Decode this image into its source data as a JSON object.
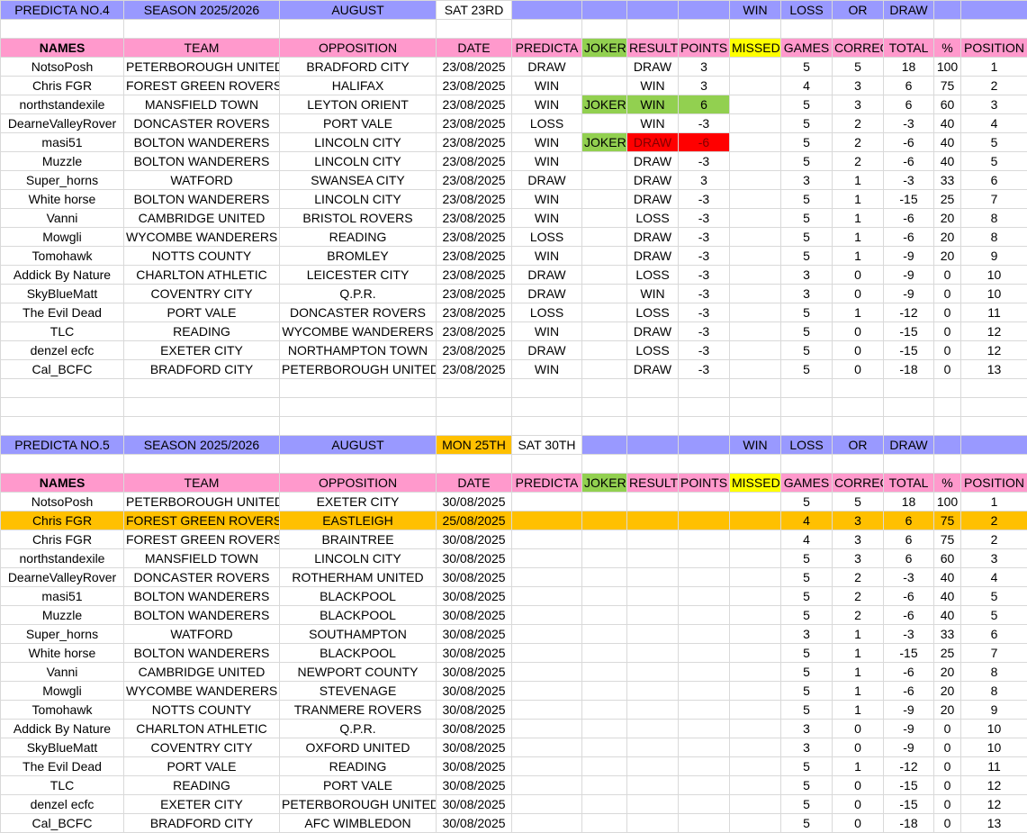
{
  "sheet1": {
    "banner": {
      "title": "PREDICTA NO.4",
      "season": "SEASON 2025/2026",
      "month": "AUGUST",
      "date1": "SAT 23RD",
      "win": "WIN",
      "loss": "LOSS",
      "or": "OR",
      "draw": "DRAW"
    },
    "headers": [
      "NAMES",
      "TEAM",
      "OPPOSITION",
      "DATE",
      "PREDICTA",
      "JOKER",
      "RESULT",
      "POINTS",
      "MISSED",
      "GAMES",
      "CORRECT",
      "TOTAL",
      "%",
      "POSITION"
    ],
    "rows": [
      [
        "NotsoPosh",
        "PETERBOROUGH UNITED",
        "BRADFORD CITY",
        "23/08/2025",
        "DRAW",
        "",
        "DRAW",
        "3",
        "",
        "5",
        "5",
        "18",
        "100",
        "1"
      ],
      [
        "Chris FGR",
        "FOREST GREEN ROVERS",
        "HALIFAX",
        "23/08/2025",
        "WIN",
        "",
        "WIN",
        "3",
        "",
        "4",
        "3",
        "6",
        "75",
        "2"
      ],
      [
        "northstandexile",
        "MANSFIELD TOWN",
        "LEYTON ORIENT",
        "23/08/2025",
        "WIN",
        "JOKER",
        "WIN",
        "6",
        "",
        "5",
        "3",
        "6",
        "60",
        "3"
      ],
      [
        "DearneValleyRover",
        "DONCASTER ROVERS",
        "PORT VALE",
        "23/08/2025",
        "LOSS",
        "",
        "WIN",
        "-3",
        "",
        "5",
        "2",
        "-3",
        "40",
        "4"
      ],
      [
        "masi51",
        "BOLTON WANDERERS",
        "LINCOLN CITY",
        "23/08/2025",
        "WIN",
        "JOKER",
        "DRAW",
        "-6",
        "",
        "5",
        "2",
        "-6",
        "40",
        "5"
      ],
      [
        "Muzzle",
        "BOLTON WANDERERS",
        "LINCOLN CITY",
        "23/08/2025",
        "WIN",
        "",
        "DRAW",
        "-3",
        "",
        "5",
        "2",
        "-6",
        "40",
        "5"
      ],
      [
        "Super_horns",
        "WATFORD",
        "SWANSEA CITY",
        "23/08/2025",
        "DRAW",
        "",
        "DRAW",
        "3",
        "",
        "3",
        "1",
        "-3",
        "33",
        "6"
      ],
      [
        "White horse",
        "BOLTON WANDERERS",
        "LINCOLN CITY",
        "23/08/2025",
        "WIN",
        "",
        "DRAW",
        "-3",
        "",
        "5",
        "1",
        "-15",
        "25",
        "7"
      ],
      [
        "Vanni",
        "CAMBRIDGE UNITED",
        "BRISTOL ROVERS",
        "23/08/2025",
        "WIN",
        "",
        "LOSS",
        "-3",
        "",
        "5",
        "1",
        "-6",
        "20",
        "8"
      ],
      [
        "Mowgli",
        "WYCOMBE WANDERERS",
        "READING",
        "23/08/2025",
        "LOSS",
        "",
        "DRAW",
        "-3",
        "",
        "5",
        "1",
        "-6",
        "20",
        "8"
      ],
      [
        "Tomohawk",
        "NOTTS COUNTY",
        "BROMLEY",
        "23/08/2025",
        "WIN",
        "",
        "DRAW",
        "-3",
        "",
        "5",
        "1",
        "-9",
        "20",
        "9"
      ],
      [
        "Addick By Nature",
        "CHARLTON ATHLETIC",
        "LEICESTER CITY",
        "23/08/2025",
        "DRAW",
        "",
        "LOSS",
        "-3",
        "",
        "3",
        "0",
        "-9",
        "0",
        "10"
      ],
      [
        "SkyBlueMatt",
        "COVENTRY CITY",
        "Q.P.R.",
        "23/08/2025",
        "DRAW",
        "",
        "WIN",
        "-3",
        "",
        "3",
        "0",
        "-9",
        "0",
        "10"
      ],
      [
        "The Evil Dead",
        "PORT VALE",
        "DONCASTER ROVERS",
        "23/08/2025",
        "LOSS",
        "",
        "LOSS",
        "-3",
        "",
        "5",
        "1",
        "-12",
        "0",
        "11"
      ],
      [
        "TLC",
        "READING",
        "WYCOMBE WANDERERS",
        "23/08/2025",
        "WIN",
        "",
        "DRAW",
        "-3",
        "",
        "5",
        "0",
        "-15",
        "0",
        "12"
      ],
      [
        "denzel ecfc",
        "EXETER CITY",
        "NORTHAMPTON TOWN",
        "23/08/2025",
        "DRAW",
        "",
        "LOSS",
        "-3",
        "",
        "5",
        "0",
        "-15",
        "0",
        "12"
      ],
      [
        "Cal_BCFC",
        "BRADFORD CITY",
        "PETERBOROUGH UNITED",
        "23/08/2025",
        "WIN",
        "",
        "DRAW",
        "-3",
        "",
        "5",
        "0",
        "-18",
        "0",
        "13"
      ]
    ]
  },
  "sheet2": {
    "banner": {
      "title": "PREDICTA NO.5",
      "season": "SEASON 2025/2026",
      "month": "AUGUST",
      "date0": "MON 25TH",
      "date1": "SAT 30TH",
      "win": "WIN",
      "loss": "LOSS",
      "or": "OR",
      "draw": "DRAW"
    },
    "headers": [
      "NAMES",
      "TEAM",
      "OPPOSITION",
      "DATE",
      "PREDICTA",
      "JOKER",
      "RESULT",
      "POINTS",
      "MISSED",
      "GAMES",
      "CORRECT",
      "TOTAL",
      "%",
      "POSITION"
    ],
    "rows": [
      [
        "NotsoPosh",
        "PETERBOROUGH UNITED",
        "EXETER CITY",
        "30/08/2025",
        "",
        "",
        "",
        "",
        "",
        "5",
        "5",
        "18",
        "100",
        "1"
      ],
      [
        "Chris FGR",
        "FOREST GREEN ROVERS",
        "EASTLEIGH",
        "25/08/2025",
        "",
        "",
        "",
        "",
        "",
        "4",
        "3",
        "6",
        "75",
        "2"
      ],
      [
        "Chris FGR",
        "FOREST GREEN ROVERS",
        "BRAINTREE",
        "30/08/2025",
        "",
        "",
        "",
        "",
        "",
        "4",
        "3",
        "6",
        "75",
        "2"
      ],
      [
        "northstandexile",
        "MANSFIELD TOWN",
        "LINCOLN CITY",
        "30/08/2025",
        "",
        "",
        "",
        "",
        "",
        "5",
        "3",
        "6",
        "60",
        "3"
      ],
      [
        "DearneValleyRover",
        "DONCASTER ROVERS",
        "ROTHERHAM UNITED",
        "30/08/2025",
        "",
        "",
        "",
        "",
        "",
        "5",
        "2",
        "-3",
        "40",
        "4"
      ],
      [
        "masi51",
        "BOLTON WANDERERS",
        "BLACKPOOL",
        "30/08/2025",
        "",
        "",
        "",
        "",
        "",
        "5",
        "2",
        "-6",
        "40",
        "5"
      ],
      [
        "Muzzle",
        "BOLTON WANDERERS",
        "BLACKPOOL",
        "30/08/2025",
        "",
        "",
        "",
        "",
        "",
        "5",
        "2",
        "-6",
        "40",
        "5"
      ],
      [
        "Super_horns",
        "WATFORD",
        "SOUTHAMPTON",
        "30/08/2025",
        "",
        "",
        "",
        "",
        "",
        "3",
        "1",
        "-3",
        "33",
        "6"
      ],
      [
        "White horse",
        "BOLTON WANDERERS",
        "BLACKPOOL",
        "30/08/2025",
        "",
        "",
        "",
        "",
        "",
        "5",
        "1",
        "-15",
        "25",
        "7"
      ],
      [
        "Vanni",
        "CAMBRIDGE UNITED",
        "NEWPORT COUNTY",
        "30/08/2025",
        "",
        "",
        "",
        "",
        "",
        "5",
        "1",
        "-6",
        "20",
        "8"
      ],
      [
        "Mowgli",
        "WYCOMBE WANDERERS",
        "STEVENAGE",
        "30/08/2025",
        "",
        "",
        "",
        "",
        "",
        "5",
        "1",
        "-6",
        "20",
        "8"
      ],
      [
        "Tomohawk",
        "NOTTS COUNTY",
        "TRANMERE ROVERS",
        "30/08/2025",
        "",
        "",
        "",
        "",
        "",
        "5",
        "1",
        "-9",
        "20",
        "9"
      ],
      [
        "Addick By Nature",
        "CHARLTON ATHLETIC",
        "Q.P.R.",
        "30/08/2025",
        "",
        "",
        "",
        "",
        "",
        "3",
        "0",
        "-9",
        "0",
        "10"
      ],
      [
        "SkyBlueMatt",
        "COVENTRY CITY",
        "OXFORD UNITED",
        "30/08/2025",
        "",
        "",
        "",
        "",
        "",
        "3",
        "0",
        "-9",
        "0",
        "10"
      ],
      [
        "The Evil Dead",
        "PORT VALE",
        "READING",
        "30/08/2025",
        "",
        "",
        "",
        "",
        "",
        "5",
        "1",
        "-12",
        "0",
        "11"
      ],
      [
        "TLC",
        "READING",
        "PORT VALE",
        "30/08/2025",
        "",
        "",
        "",
        "",
        "",
        "5",
        "0",
        "-15",
        "0",
        "12"
      ],
      [
        "denzel ecfc",
        "EXETER CITY",
        "PETERBOROUGH UNITED",
        "30/08/2025",
        "",
        "",
        "",
        "",
        "",
        "5",
        "0",
        "-15",
        "0",
        "12"
      ],
      [
        "Cal_BCFC",
        "BRADFORD CITY",
        "AFC WIMBLEDON",
        "30/08/2025",
        "",
        "",
        "",
        "",
        "",
        "5",
        "0",
        "-18",
        "0",
        "13"
      ]
    ]
  },
  "colors": {
    "banner": "#9999ff",
    "header": "#ff99cc",
    "joker": "#92d050",
    "missed": "#ffff00",
    "highlight": "#ffc000",
    "loss_joker": "#ff0000"
  }
}
